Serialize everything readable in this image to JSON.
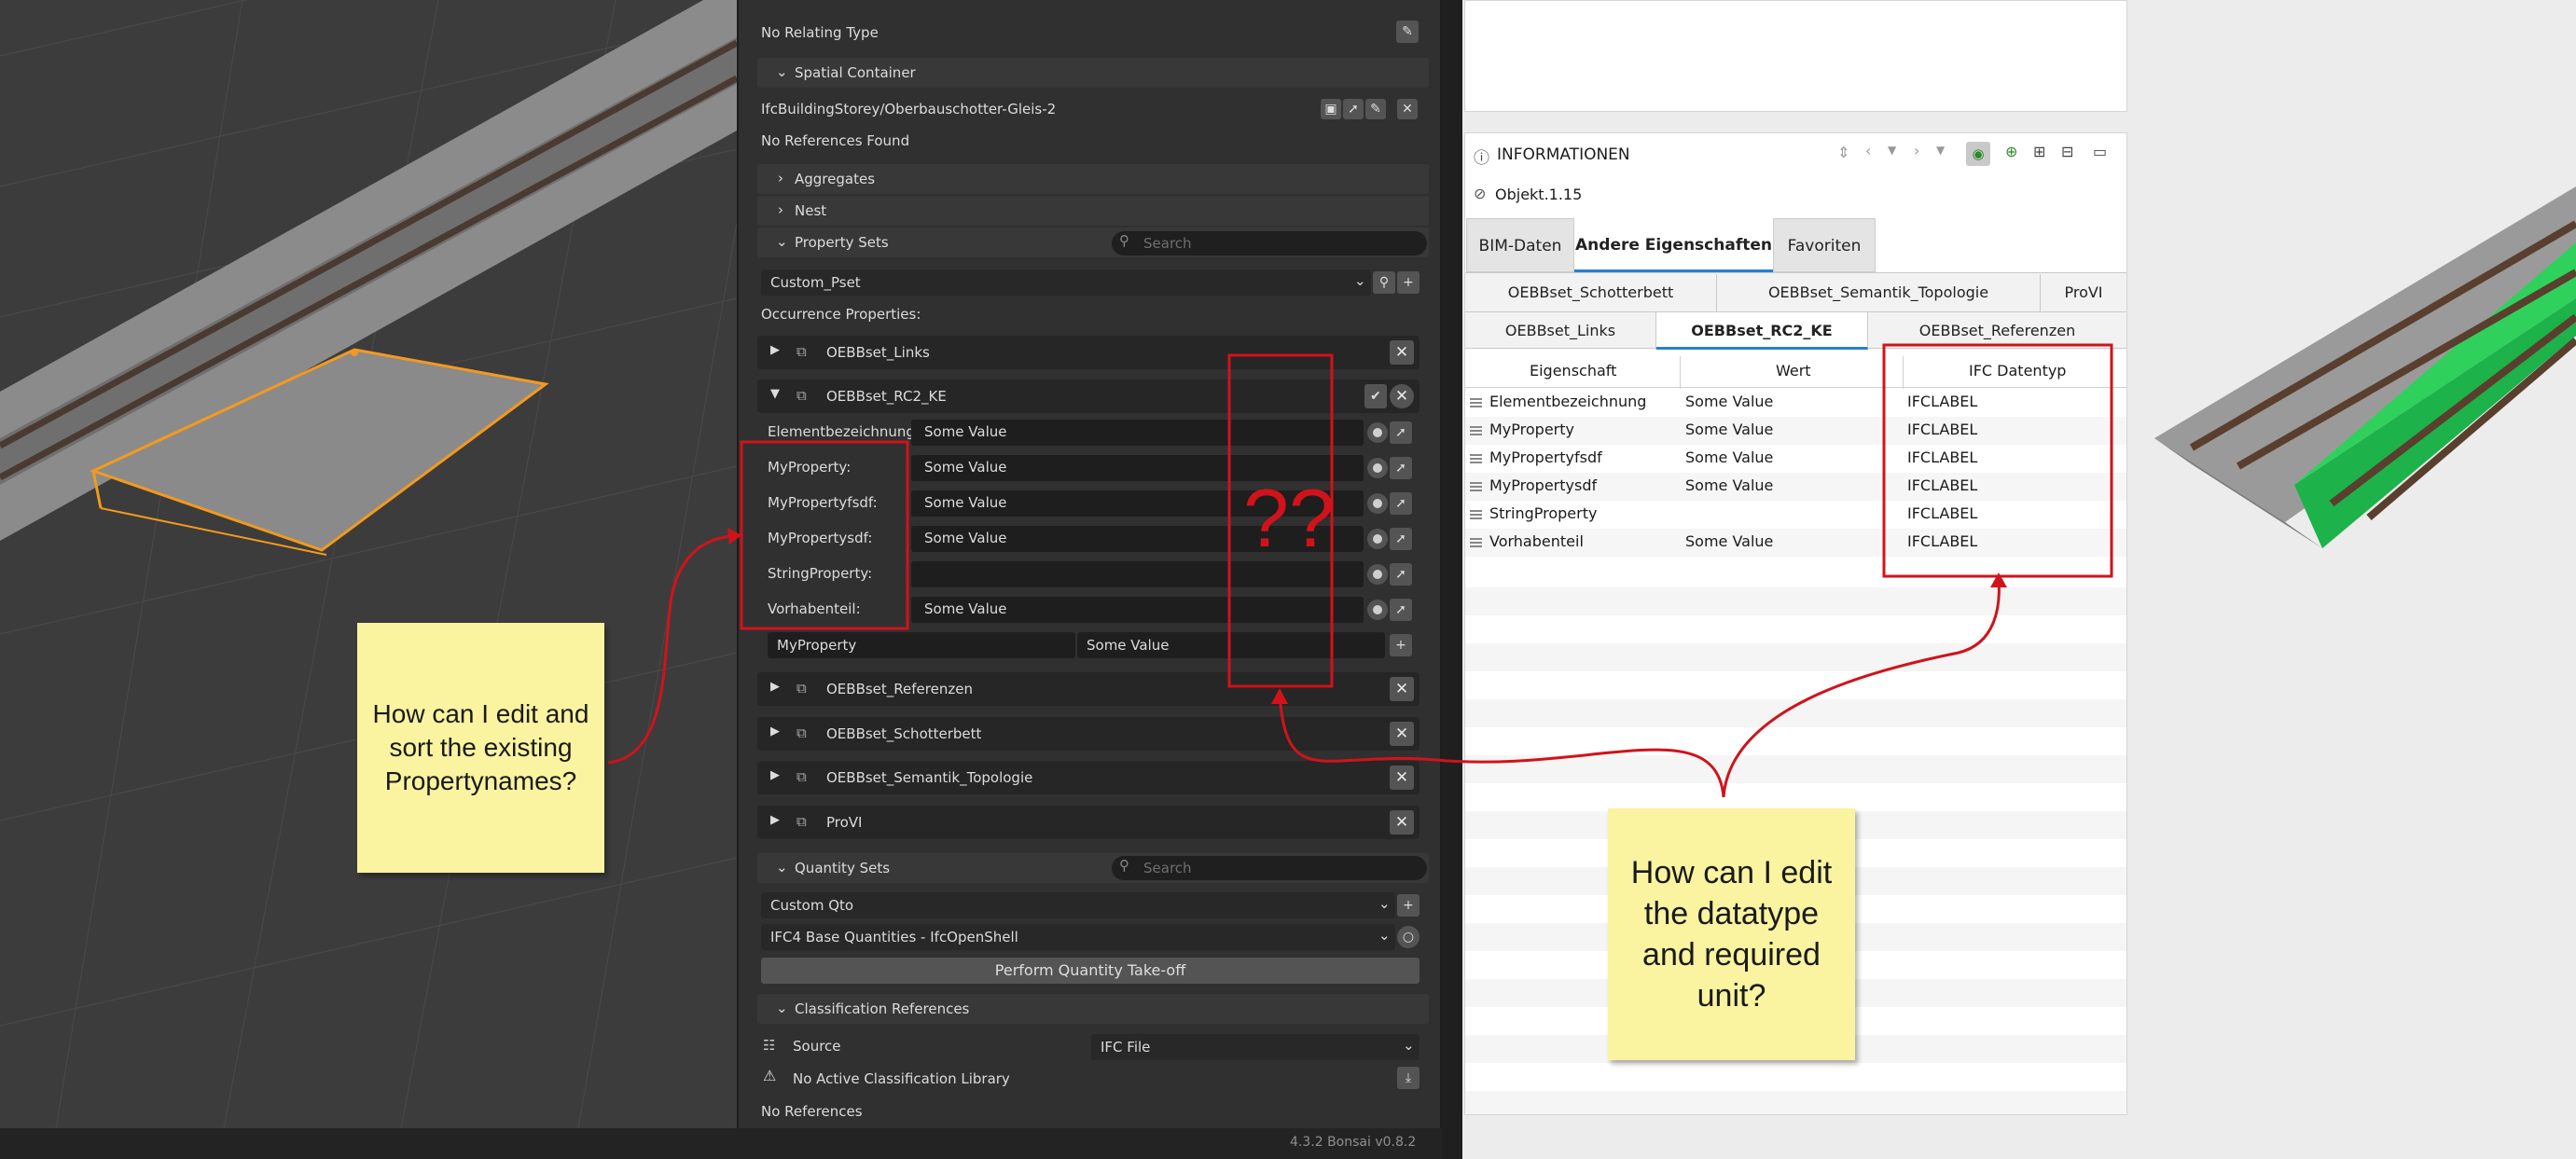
{
  "blender": {
    "relating_type": "No Relating Type",
    "spatial_container": {
      "header": "Spatial Container",
      "value": "IfcBuildingStorey/Oberbauschotter-Gleis-2",
      "no_refs": "No References Found"
    },
    "aggregates": "Aggregates",
    "nest": "Nest",
    "property_sets": {
      "header": "Property Sets",
      "search_placeholder": "Search",
      "pset_select": "Custom_Pset",
      "occurrence": "Occurrence Properties:",
      "psets": [
        "OEBBset_Links",
        "OEBBset_RC2_KE",
        "OEBBset_Referenzen",
        "OEBBset_Schotterbett",
        "OEBBset_Semantik_Topologie",
        "ProVI"
      ],
      "props": [
        {
          "name": "Elementbezeichnung:",
          "value": "Some Value"
        },
        {
          "name": "MyProperty:",
          "value": "Some Value"
        },
        {
          "name": "MyPropertyfsdf:",
          "value": "Some Value"
        },
        {
          "name": "MyPropertysdf:",
          "value": "Some Value"
        },
        {
          "name": "StringProperty:",
          "value": ""
        },
        {
          "name": "Vorhabenteil:",
          "value": "Some Value"
        }
      ],
      "new_prop": {
        "name": "MyProperty",
        "value": "Some Value"
      }
    },
    "quantity_sets": {
      "header": "Quantity Sets",
      "search_placeholder": "Search",
      "qto_select": "Custom Qto",
      "base_select": "IFC4 Base Quantities - IfcOpenShell",
      "takeoff_button": "Perform Quantity Take-off"
    },
    "classification": {
      "header": "Classification References",
      "source_label": "Source",
      "source_value": "IFC File",
      "no_library": "No Active Classification Library",
      "no_refs": "No References"
    },
    "status": "4.3.2   Bonsai v0.8.2"
  },
  "info_panel": {
    "title": "INFORMATIONEN",
    "object": "Objekt.1.15",
    "tabs": [
      "BIM-Daten",
      "Andere Eigenschaften",
      "Favoriten"
    ],
    "active_tab": "Andere Eigenschaften",
    "subtabs_row1": [
      "OEBBset_Schotterbett",
      "OEBBset_Semantik_Topologie",
      "ProVI"
    ],
    "subtabs_row2": [
      "OEBBset_Links",
      "OEBBset_RC2_KE",
      "OEBBset_Referenzen"
    ],
    "active_subtab": "OEBBset_RC2_KE",
    "columns": [
      "Eigenschaft",
      "Wert",
      "IFC Datentyp"
    ],
    "rows": [
      {
        "name": "Elementbezeichnung",
        "value": "Some Value",
        "type": "IFCLABEL"
      },
      {
        "name": "MyProperty",
        "value": "Some Value",
        "type": "IFCLABEL"
      },
      {
        "name": "MyPropertyfsdf",
        "value": "Some Value",
        "type": "IFCLABEL"
      },
      {
        "name": "MyPropertysdf",
        "value": "Some Value",
        "type": "IFCLABEL"
      },
      {
        "name": "StringProperty",
        "value": "",
        "type": "IFCLABEL"
      },
      {
        "name": "Vorhabenteil",
        "value": "Some Value",
        "type": "IFCLABEL"
      }
    ]
  },
  "annotations": {
    "qq": "??",
    "note_left": "How can I edit and sort the existing Propertynames?",
    "note_right": "How can I edit the datatype and required unit?",
    "color": "#d0131b"
  }
}
